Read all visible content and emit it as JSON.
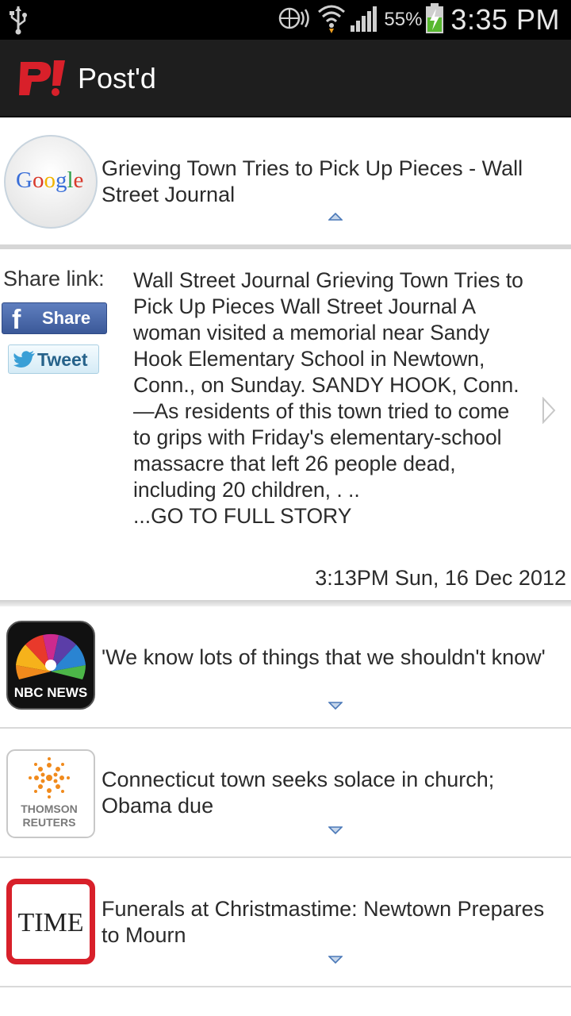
{
  "status_bar": {
    "battery_pct": "55%",
    "time": "3:35 PM",
    "icons": [
      "usb-icon",
      "nfc-icon",
      "wifi-icon",
      "signal-icon",
      "battery-charging-icon"
    ]
  },
  "app": {
    "title": "Post'd",
    "logo_text": "P!"
  },
  "feed": {
    "first_item": {
      "source": "Google",
      "title": "Grieving Town Tries to Pick Up Pieces - Wall Street Journal"
    },
    "expanded": {
      "share_label": "Share link:",
      "facebook_label": "Share",
      "twitter_label": "Tweet",
      "summary": "Wall Street Journal Grieving Town Tries to Pick Up Pieces Wall Street Journal A woman visited a memorial near Sandy Hook Elementary School in Newtown, Conn., on Sunday. SANDY HOOK, Conn. —As residents of this town tried to come to grips with Friday's elementary-school massacre that left 26 people dead, including 20 children, . ..",
      "read_more": "...GO TO FULL STORY",
      "timestamp": "3:13PM Sun, 16 Dec 2012"
    },
    "items": [
      {
        "source": "NBC NEWS",
        "title": "'We know lots of things that we shouldn't know'"
      },
      {
        "source": "THOMSON REUTERS",
        "title": "Connecticut town seeks solace in church; Obama due"
      },
      {
        "source": "TIME",
        "title": "Funerals at Christmastime: Newtown Prepares to Mourn"
      }
    ]
  },
  "colors": {
    "app_bar": "#1e1e1e",
    "accent_chevron": "#4a78b8",
    "facebook": "#3b5998",
    "logo_red": "#d8202a"
  }
}
